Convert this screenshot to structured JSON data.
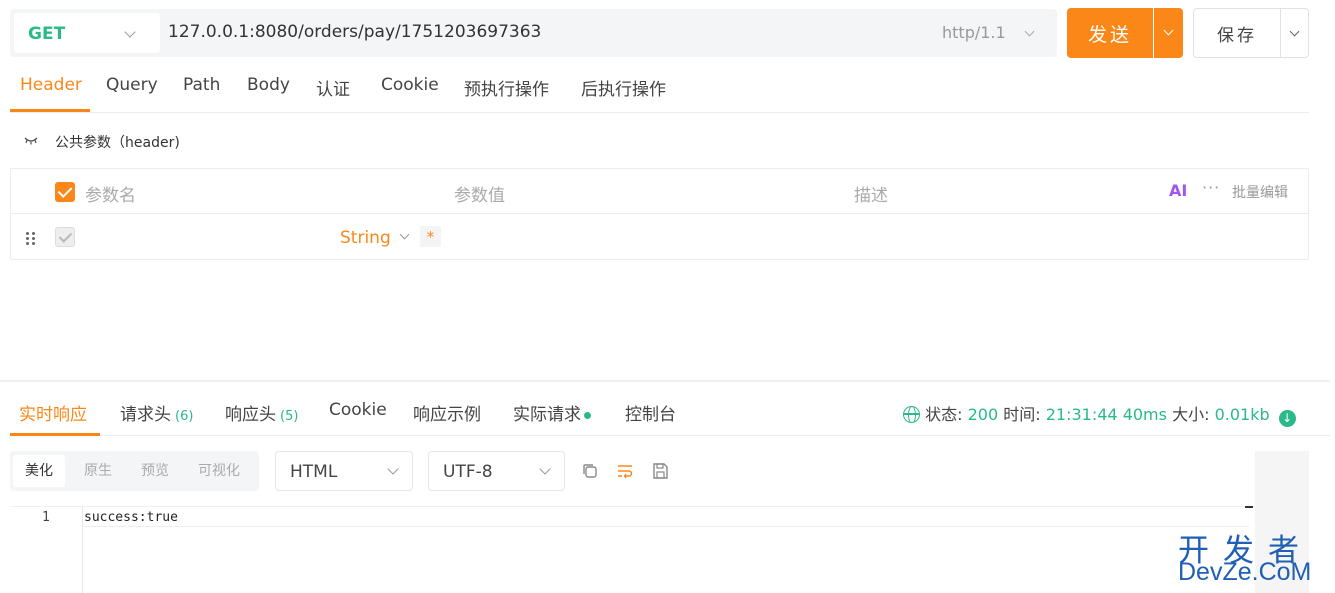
{
  "request": {
    "method": "GET",
    "url": "127.0.0.1:8080/orders/pay/1751203697363",
    "http_version": "http/1.1",
    "send_label": "发送",
    "save_label": "保存"
  },
  "request_tabs": [
    "Header",
    "Query",
    "Path",
    "Body",
    "认证",
    "Cookie",
    "预执行操作",
    "后执行操作"
  ],
  "public_params": {
    "label": "公共参数（header)"
  },
  "params_table": {
    "col_name": "参数名",
    "col_value": "参数值",
    "col_desc": "描述",
    "ai_label": "AI",
    "more": "···",
    "bulk_edit": "批量编辑",
    "row": {
      "type": "String",
      "required": "*"
    }
  },
  "response_tabs": {
    "realtime": "实时响应",
    "req_headers": "请求头",
    "req_headers_count": "(6)",
    "resp_headers": "响应头",
    "resp_headers_count": "(5)",
    "cookie": "Cookie",
    "examples": "响应示例",
    "actual_request": "实际请求",
    "console": "控制台"
  },
  "status": {
    "status_label": "状态:",
    "status_code": "200",
    "time_label": "时间:",
    "time_value": "21:31:44",
    "duration": "40ms",
    "size_label": "大小:",
    "size_value": "0.01kb"
  },
  "body_view": {
    "modes": [
      "美化",
      "原生",
      "预览",
      "可视化"
    ],
    "format": "HTML",
    "encoding": "UTF-8"
  },
  "editor": {
    "line_number": "1",
    "content": "success:true"
  },
  "watermark": {
    "cn": "开发者",
    "en": "DevZe.CoM"
  },
  "colors": {
    "accent": "#fc8719",
    "success": "#2ab98a",
    "watermark": "#1f5fb5"
  }
}
